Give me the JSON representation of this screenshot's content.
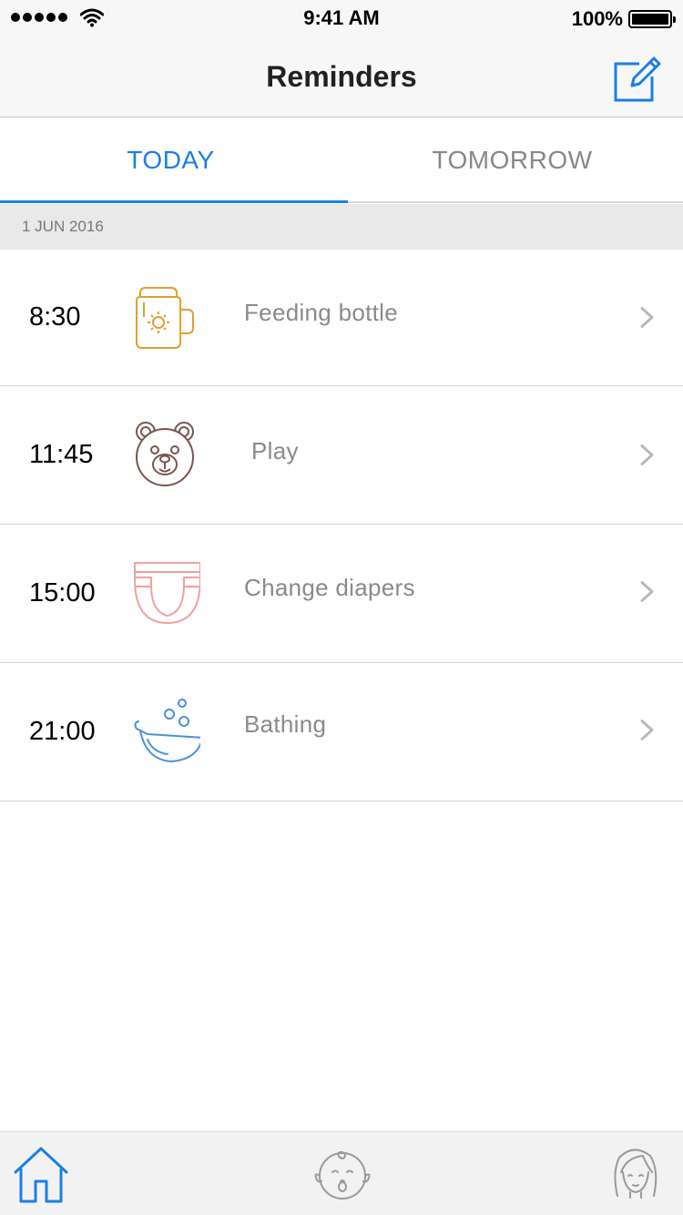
{
  "status_bar": {
    "time": "9:41 AM",
    "battery": "100%"
  },
  "nav": {
    "title": "Reminders",
    "compose_icon": "compose-icon"
  },
  "tabs": [
    {
      "label": "TODAY",
      "selected": true
    },
    {
      "label": "TOMORROW",
      "selected": false
    }
  ],
  "section": {
    "date": "1 JUN 2016"
  },
  "reminders": [
    {
      "time": "8:30",
      "label": "Feeding bottle",
      "icon": "feeding-bottle-icon",
      "color": "#e0a030"
    },
    {
      "time": "11:45",
      "label": "Play",
      "icon": "teddy-bear-icon",
      "color": "#7a5550"
    },
    {
      "time": "15:00",
      "label": "Change diapers",
      "icon": "diaper-icon",
      "color": "#f0a0a0"
    },
    {
      "time": "21:00",
      "label": "Bathing",
      "icon": "bathtub-icon",
      "color": "#4a90d9"
    }
  ],
  "tab_bar": [
    {
      "icon": "home-icon",
      "selected": true
    },
    {
      "icon": "baby-icon",
      "selected": false
    },
    {
      "icon": "mother-icon",
      "selected": false
    }
  ],
  "colors": {
    "accent": "#1a7fe6",
    "muted_text": "#8a8a8a"
  }
}
